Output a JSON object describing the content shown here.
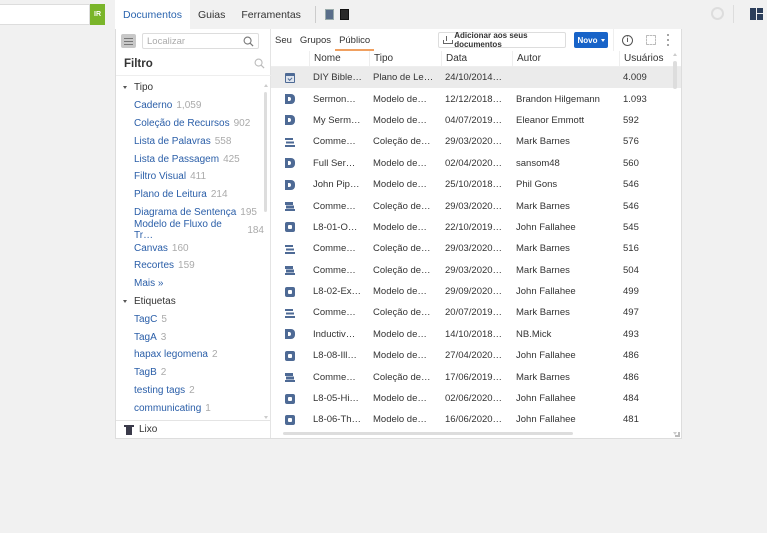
{
  "topbar": {
    "search_value": "",
    "go_label": "IR",
    "tabs": [
      {
        "label": "Documentos",
        "active": true
      },
      {
        "label": "Guias",
        "active": false
      },
      {
        "label": "Ferramentas",
        "active": false
      }
    ],
    "icons": [
      "book-icon",
      "phone-icon",
      "sync-spinner-icon",
      "layout-icon"
    ]
  },
  "sidebar": {
    "search_placeholder": "Localizar",
    "filter_title": "Filtro",
    "groups": [
      {
        "label": "Tipo",
        "items": [
          {
            "label": "Caderno",
            "count": "1,059"
          },
          {
            "label": "Coleção de Recursos",
            "count": "902"
          },
          {
            "label": "Lista de Palavras",
            "count": "558"
          },
          {
            "label": "Lista de Passagem",
            "count": "425"
          },
          {
            "label": "Filtro Visual",
            "count": "411"
          },
          {
            "label": "Plano de Leitura",
            "count": "214"
          },
          {
            "label": "Diagrama de Sentença",
            "count": "195"
          },
          {
            "label": "Modelo de Fluxo de Tr…",
            "count": "184"
          },
          {
            "label": "Canvas",
            "count": "160"
          },
          {
            "label": "Recortes",
            "count": "159"
          },
          {
            "label": "Mais »",
            "count": ""
          }
        ]
      },
      {
        "label": "Etiquetas",
        "items": [
          {
            "label": "TagC",
            "count": "5"
          },
          {
            "label": "TagA",
            "count": "3"
          },
          {
            "label": "hapax legomena",
            "count": "2"
          },
          {
            "label": "TagB",
            "count": "2"
          },
          {
            "label": "testing tags",
            "count": "2"
          },
          {
            "label": "communicating",
            "count": "1"
          }
        ]
      }
    ],
    "trash_label": "Lixo"
  },
  "main": {
    "subtabs": [
      {
        "label": "Seu",
        "active": false
      },
      {
        "label": "Grupos",
        "active": false
      },
      {
        "label": "Público",
        "active": true
      }
    ],
    "add_button_label": "Adicionar aos seus documentos",
    "new_button_label": "Novo",
    "info_icon_glyph": "i",
    "columns": [
      "",
      "Nome",
      "Tipo",
      "Data",
      "Autor",
      "Usuários"
    ],
    "rows": [
      {
        "icon": "cal",
        "name": "DIY Bible…",
        "type": "Plano de Le…",
        "date": "24/10/2014…",
        "author": "",
        "users": "4.009",
        "selected": true
      },
      {
        "icon": "doc",
        "name": "Sermon…",
        "type": "Modelo de…",
        "date": "12/12/2018…",
        "author": "Brandon Hilgemann",
        "users": "1.093"
      },
      {
        "icon": "doc",
        "name": "My Serm…",
        "type": "Modelo de…",
        "date": "04/07/2019…",
        "author": "Eleanor Emmott",
        "users": "592"
      },
      {
        "icon": "coll",
        "name": "Comme…",
        "type": "Coleção de…",
        "date": "29/03/2020…",
        "author": "Mark Barnes",
        "users": "576"
      },
      {
        "icon": "doc",
        "name": "Full Ser…",
        "type": "Modelo de…",
        "date": "02/04/2020…",
        "author": "sansom48",
        "users": "560"
      },
      {
        "icon": "doc",
        "name": "John Pip…",
        "type": "Modelo de…",
        "date": "25/10/2018…",
        "author": "Phil Gons",
        "users": "546"
      },
      {
        "icon": "coll",
        "name": "Comme…",
        "type": "Coleção de…",
        "date": "29/03/2020…",
        "author": "Mark Barnes",
        "users": "546"
      },
      {
        "icon": "hex",
        "name": "L8-01-O…",
        "type": "Modelo de…",
        "date": "22/10/2019…",
        "author": "John Fallahee",
        "users": "545"
      },
      {
        "icon": "coll",
        "name": "Comme…",
        "type": "Coleção de…",
        "date": "29/03/2020…",
        "author": "Mark Barnes",
        "users": "516"
      },
      {
        "icon": "coll",
        "name": "Comme…",
        "type": "Coleção de…",
        "date": "29/03/2020…",
        "author": "Mark Barnes",
        "users": "504"
      },
      {
        "icon": "hex",
        "name": "L8-02-Ex…",
        "type": "Modelo de…",
        "date": "29/09/2020…",
        "author": "John Fallahee",
        "users": "499"
      },
      {
        "icon": "coll",
        "name": "Comme…",
        "type": "Coleção de…",
        "date": "20/07/2019…",
        "author": "Mark Barnes",
        "users": "497"
      },
      {
        "icon": "doc",
        "name": "Inductiv…",
        "type": "Modelo de…",
        "date": "14/10/2018…",
        "author": "NB.Mick",
        "users": "493"
      },
      {
        "icon": "hex",
        "name": "L8-08-Ill…",
        "type": "Modelo de…",
        "date": "27/04/2020…",
        "author": "John Fallahee",
        "users": "486"
      },
      {
        "icon": "coll",
        "name": "Comme…",
        "type": "Coleção de…",
        "date": "17/06/2019…",
        "author": "Mark Barnes",
        "users": "486"
      },
      {
        "icon": "hex",
        "name": "L8-05-Hi…",
        "type": "Modelo de…",
        "date": "02/06/2020…",
        "author": "John Fallahee",
        "users": "484"
      },
      {
        "icon": "hex",
        "name": "L8-06-Th…",
        "type": "Modelo de…",
        "date": "16/06/2020…",
        "author": "John Fallahee",
        "users": "481"
      }
    ]
  },
  "colors": {
    "accent": "#2a64ae",
    "go_button": "#7ab52a",
    "new_button": "#1763c8",
    "active_subtab_underline": "#f0a060",
    "row_icon": "#4e6a95",
    "selected_row": "#ebebeb"
  }
}
